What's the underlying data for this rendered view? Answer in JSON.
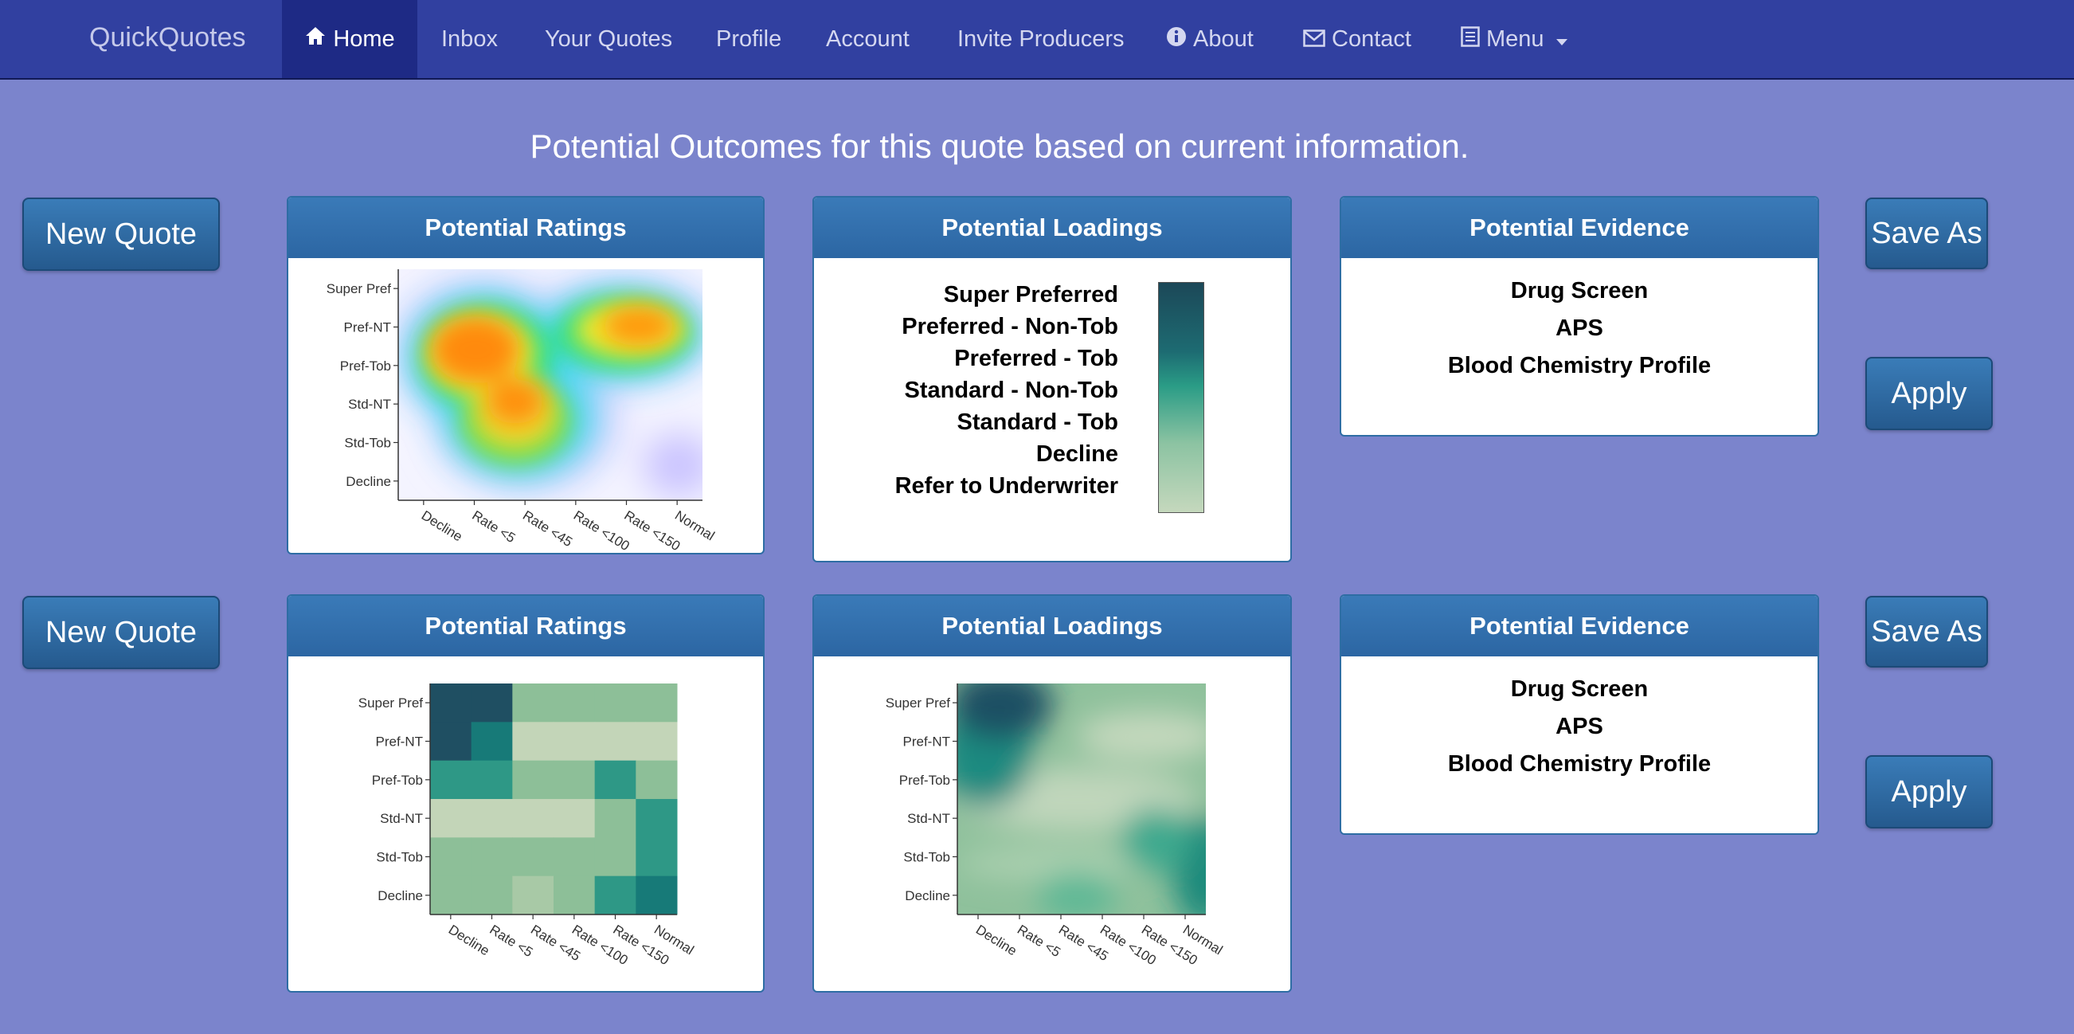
{
  "nav": {
    "brand": "QuickQuotes",
    "items": [
      {
        "label": "Home",
        "icon": "home-icon",
        "active": true
      },
      {
        "label": "Inbox"
      },
      {
        "label": "Your Quotes"
      },
      {
        "label": "Profile"
      },
      {
        "label": "Account"
      },
      {
        "label": "Invite Producers"
      },
      {
        "label": "About",
        "icon": "info-icon"
      },
      {
        "label": "Contact",
        "icon": "envelope-icon"
      },
      {
        "label": "Menu",
        "icon": "list-icon",
        "dropdown": true
      }
    ]
  },
  "heading": "Potential Outcomes for this quote based on current information.",
  "buttons": {
    "new_quote": "New Quote",
    "save_as": "Save As",
    "apply": "Apply"
  },
  "rows": [
    {
      "ratings_title": "Potential Ratings",
      "loadings_title": "Potential Loadings",
      "evidence_title": "Potential Evidence",
      "evidence": [
        "Drug Screen",
        "APS",
        "Blood Chemistry Profile"
      ],
      "loadings_legend": [
        "Super Preferred",
        "Preferred - Non-Tob",
        "Preferred - Tob",
        "Standard - Non-Tob",
        "Standard - Tob",
        "Decline",
        "Refer to Underwriter"
      ]
    },
    {
      "ratings_title": "Potential Ratings",
      "loadings_title": "Potential Loadings",
      "evidence_title": "Potential Evidence",
      "evidence": [
        "Drug Screen",
        "APS",
        "Blood Chemistry Profile"
      ]
    }
  ],
  "chart_data": [
    {
      "type": "heatmap",
      "title": "Potential Ratings",
      "style": "smoothed density, jet colormap",
      "x": [
        "Decline",
        "Rate <5",
        "Rate <45",
        "Rate <100",
        "Rate <150",
        "Normal"
      ],
      "y": [
        "Super Pref",
        "Pref-NT",
        "Pref-Tob",
        "Std-NT",
        "Std-Tob",
        "Decline"
      ]
    },
    {
      "type": "heatmap",
      "title": "Potential Ratings",
      "style": "discrete cells, teal colormap",
      "x": [
        "Decline",
        "Rate <5",
        "Rate <45",
        "Rate <100",
        "Rate <150",
        "Normal"
      ],
      "y": [
        "Super Pref",
        "Pref-NT",
        "Pref-Tob",
        "Std-NT",
        "Std-Tob",
        "Decline"
      ],
      "levels": [
        [
          4,
          4,
          1,
          1,
          1,
          1
        ],
        [
          4,
          3,
          0,
          0,
          0,
          0
        ],
        [
          2,
          2,
          1,
          1,
          2,
          1
        ],
        [
          0,
          0,
          0,
          0,
          1,
          2
        ],
        [
          1,
          1,
          1,
          1,
          1,
          2
        ],
        [
          1,
          1,
          0.5,
          1,
          2,
          3
        ]
      ],
      "colors": [
        "#c3d5b8",
        "#8dbf98",
        "#2e9886",
        "#177a78",
        "#1f4f62"
      ]
    },
    {
      "type": "heatmap",
      "title": "Potential Loadings",
      "style": "smoothed, teal colormap",
      "x": [
        "Decline",
        "Rate <5",
        "Rate <45",
        "Rate <100",
        "Rate <150",
        "Normal"
      ],
      "y": [
        "Super Pref",
        "Pref-NT",
        "Pref-Tob",
        "Std-NT",
        "Std-Tob",
        "Decline"
      ]
    }
  ]
}
